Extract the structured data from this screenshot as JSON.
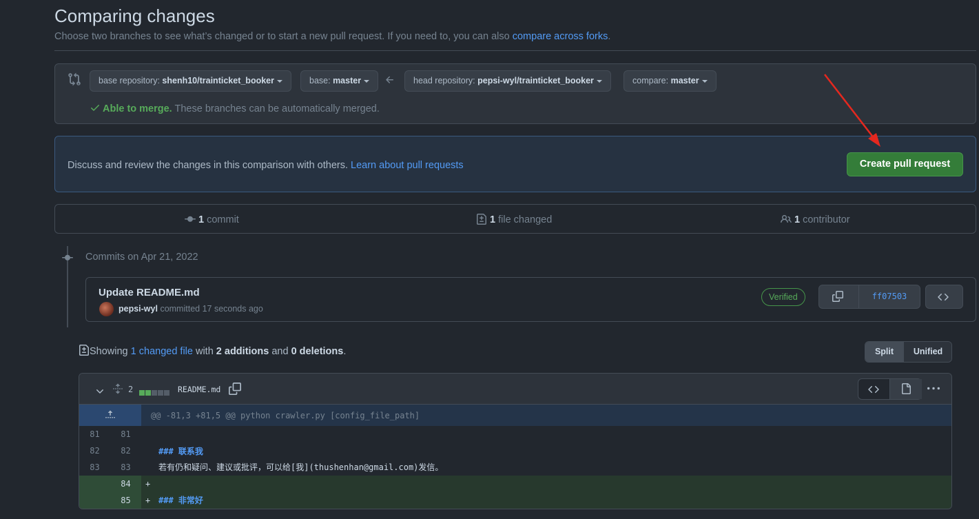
{
  "header": {
    "title": "Comparing changes",
    "subtitle": "Choose two branches to see what’s changed or to start a new pull request. If you need to, you can also ",
    "subtitle_link": "compare across forks",
    "subtitle_end": "."
  },
  "range": {
    "base_repo_label": "base repository: ",
    "base_repo_value": "shenh10/trainticket_booker",
    "base_label": "base: ",
    "base_value": "master",
    "head_repo_label": "head repository: ",
    "head_repo_value": "pepsi-wyl/trainticket_booker",
    "compare_label": "compare: ",
    "compare_value": "master",
    "merge_ok": "Able to merge.",
    "merge_text": " These branches can be automatically merged."
  },
  "discuss": {
    "text": "Discuss and review the changes in this comparison with others. ",
    "link": "Learn about pull requests",
    "button": "Create pull request"
  },
  "stats": {
    "commits_num": "1",
    "commits_label": " commit",
    "files_num": "1",
    "files_label": " file changed",
    "contributors_num": "1",
    "contributors_label": " contributor"
  },
  "commits": {
    "date_heading": "Commits on Apr 21, 2022",
    "items": [
      {
        "title": "Update README.md",
        "author": "pepsi-wyl",
        "action": " committed 17 seconds ago",
        "badge": "Verified",
        "sha": "ff07503"
      }
    ]
  },
  "summary": {
    "prefix": "Showing ",
    "files_link": "1 changed file",
    "with": " with ",
    "additions": "2 additions",
    "and": " and ",
    "deletions": "0 deletions",
    "end": "."
  },
  "view_toggle": {
    "split": "Split",
    "unified": "Unified"
  },
  "file": {
    "change_count": "2",
    "name": "README.md",
    "hunk": "@@ -81,3 +81,5 @@ python crawler.py [config_file_path]",
    "lines": [
      {
        "type": "ctx",
        "old": "81",
        "new": "81",
        "marker": "",
        "text": ""
      },
      {
        "type": "ctx",
        "old": "82",
        "new": "82",
        "marker": "",
        "text": "### 联系我"
      },
      {
        "type": "ctx",
        "old": "83",
        "new": "83",
        "marker": "",
        "text": "若有仍和疑问、建议或批评，可以给[我](thushenhan@gmail.com)发信。"
      },
      {
        "type": "add",
        "old": "",
        "new": "84",
        "marker": "+",
        "text": ""
      },
      {
        "type": "add",
        "old": "",
        "new": "85",
        "marker": "+",
        "text": "### 非常好"
      }
    ]
  },
  "colors": {
    "background": "#22272e",
    "accent_link": "#539bf5",
    "success": "#347d39",
    "annotation_arrow": "#e5281f"
  }
}
